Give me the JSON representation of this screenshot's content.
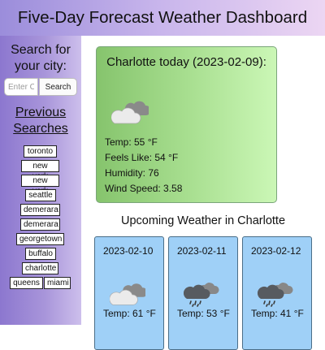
{
  "header": {
    "title": "Five-Day Forecast Weather Dashboard"
  },
  "sidebar": {
    "search_title": "Search for your city:",
    "search_placeholder": "Enter City",
    "search_button": "Search",
    "previous_title": "Previous Searches",
    "history": [
      "toronto",
      "new york",
      "new york",
      "seattle",
      "demerara",
      "demerara",
      "georgetown",
      "buffalo",
      "charlotte",
      "queens",
      "miami"
    ]
  },
  "today": {
    "title": "Charlotte today (2023-02-09):",
    "icon": "cloudy-icon",
    "temp": "Temp: 55 °F",
    "feels_like": "Feels Like: 54 °F",
    "humidity": "Humidity: 76",
    "wind": "Wind Speed: 3.58"
  },
  "upcoming": {
    "title": "Upcoming Weather in Charlotte",
    "days": [
      {
        "date": "2023-02-10",
        "icon": "cloudy-icon",
        "temp": "Temp: 61 °F"
      },
      {
        "date": "2023-02-11",
        "icon": "rain-cloud-icon",
        "temp": "Temp: 53 °F"
      },
      {
        "date": "2023-02-12",
        "icon": "rain-cloud-icon",
        "temp": "Temp: 41 °F"
      }
    ]
  }
}
